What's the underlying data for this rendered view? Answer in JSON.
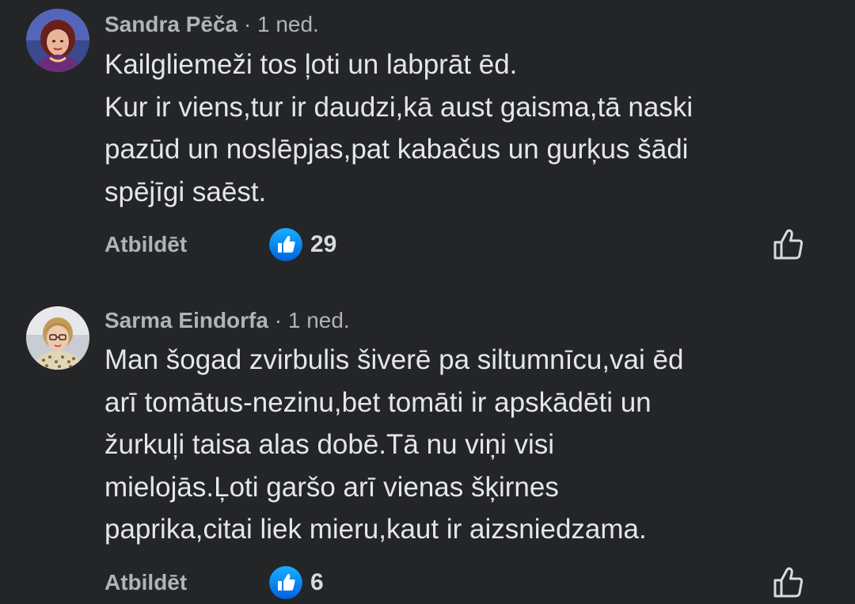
{
  "comments": [
    {
      "author": "Sandra Pēča",
      "meta": " · 1 ned.",
      "lines": [
        "Kailgliemeži tos ļoti un labprāt ēd.",
        "Kur ir viens,tur ir daudzi,kā aust gaisma,tā naski",
        "pazūd un noslēpjas,pat kabačus un gurķus šādi",
        "spējīgi saēst."
      ],
      "reply_label": "Atbildēt",
      "like_count": "29",
      "avatar_icon": "avatar-woman-dark-hair"
    },
    {
      "author": "Sarma Eindorfa",
      "meta": " · 1 ned.",
      "lines": [
        "Man šogad zvirbulis šiverē pa siltumnīcu,vai ēd",
        "arī tomātus-nezinu,bet tomāti ir apskādēti un",
        "žurkuļi taisa alas dobē.Tā nu viņi visi",
        "mielojās.Ļoti garšo arī vienas šķirnes",
        "paprika,citai liek mieru,kaut ir aizsniedzama."
      ],
      "reply_label": "Atbildēt",
      "like_count": "6",
      "avatar_icon": "avatar-woman-glasses"
    }
  ],
  "colors": {
    "background": "#242527",
    "primary_text": "#e4e6eb",
    "secondary_text": "#b0b3b8",
    "like_blue": "#1877f2"
  }
}
